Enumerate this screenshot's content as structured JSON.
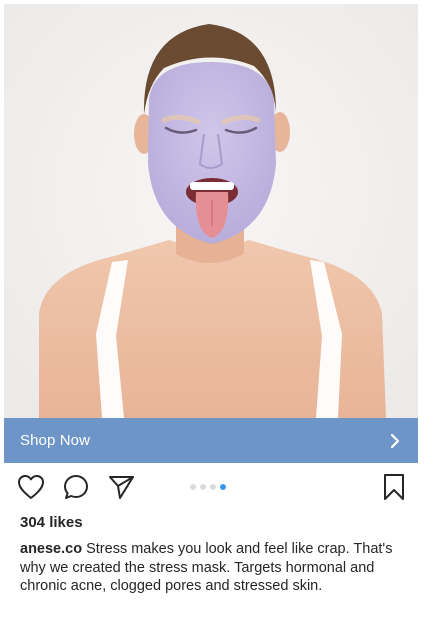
{
  "post": {
    "cta": {
      "label": "Shop Now",
      "chevron_icon": "chevron-right-icon",
      "color": "#6e95c7"
    },
    "actions": {
      "like_icon": "heart-outline-icon",
      "comment_icon": "speech-bubble-icon",
      "share_icon": "paper-plane-icon",
      "save_icon": "bookmark-outline-icon"
    },
    "carousel": {
      "total": 4,
      "active_index": 4,
      "active_color": "#3897f0"
    },
    "likes_text": "304 likes",
    "caption": {
      "username": "anese.co",
      "text": "Stress makes you look and feel like crap. That's why we created the stress mask. Targets hormonal and chronic acne, clogged pores and stressed skin."
    }
  }
}
